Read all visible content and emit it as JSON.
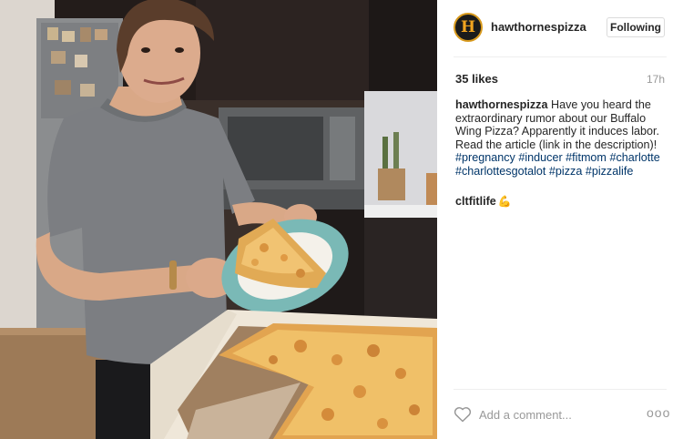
{
  "post": {
    "author": {
      "username": "hawthornespizza",
      "avatar_letter": "H"
    },
    "follow_label": "Following",
    "likes": "35 likes",
    "time": "17h",
    "caption": {
      "username": "hawthornespizza",
      "text": "Have you heard the extraordinary rumor about our Buffalo Wing Pizza? Apparently it induces labor. Read the article (link in the description)!",
      "hashtags": [
        "#pregnancy",
        "#inducer",
        "#fitmom",
        "#charlotte",
        "#charlottesgotalot",
        "#pizza",
        "#pizzalife"
      ]
    },
    "comments": [
      {
        "username": "cltfitlife",
        "emoji": "💪"
      }
    ],
    "add_comment_placeholder": "Add a comment...",
    "more_symbol": "ooo",
    "colors": {
      "hashtag": "#003569",
      "avatar_accent": "#f2a51f"
    },
    "icons": {
      "like": "heart-outline-icon",
      "more": "more-options-icon"
    }
  }
}
